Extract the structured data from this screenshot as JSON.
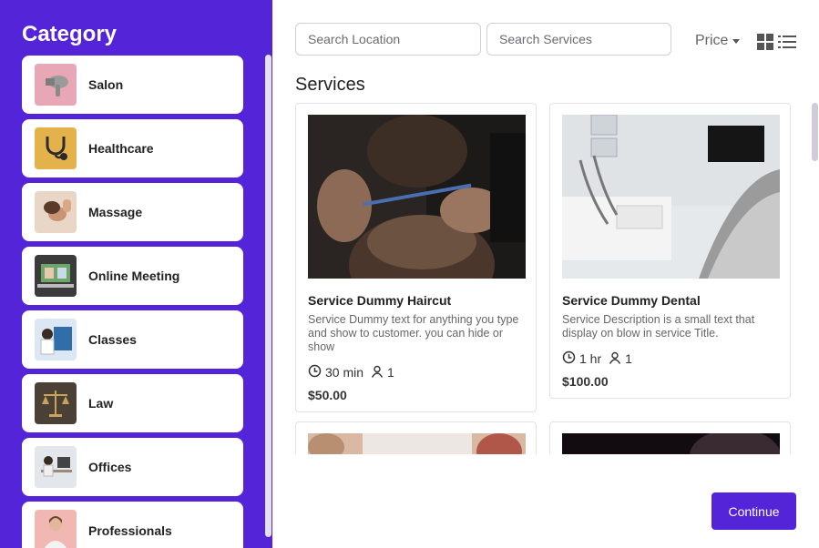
{
  "sidebar": {
    "title": "Category",
    "items": [
      {
        "label": "Salon",
        "icon": "hair-dryer-icon",
        "color": "#e8a7b6"
      },
      {
        "label": "Healthcare",
        "icon": "stethoscope-icon",
        "color": "#e3b24a"
      },
      {
        "label": "Massage",
        "icon": "massage-icon",
        "color": "#e9d6c6"
      },
      {
        "label": "Online Meeting",
        "icon": "laptop-meeting-icon",
        "color": "#3b3b3b"
      },
      {
        "label": "Classes",
        "icon": "classroom-icon",
        "color": "#8fb4d9"
      },
      {
        "label": "Law",
        "icon": "scales-icon",
        "color": "#6b5a3c"
      },
      {
        "label": "Offices",
        "icon": "office-icon",
        "color": "#d9dde3"
      },
      {
        "label": "Professionals",
        "icon": "professional-person-icon",
        "color": "#f1b7b2"
      }
    ]
  },
  "search": {
    "location_placeholder": "Search Location",
    "services_placeholder": "Search Services"
  },
  "toolbar": {
    "price_label": "Price",
    "grid_view_icon": "grid-view-icon",
    "list_view_icon": "list-view-icon"
  },
  "main": {
    "section_title": "Services",
    "cards": [
      {
        "title": "Service Dummy Haircut",
        "description": "Service Dummy text for anything you type and show to customer. you can hide or show",
        "duration": "30 min",
        "capacity": "1",
        "price": "$50.00"
      },
      {
        "title": "Service Dummy Dental",
        "description": "Service Description is a small text that display on blow in service Title.",
        "duration": "1 hr",
        "capacity": "1",
        "price": "$100.00"
      }
    ]
  },
  "footer": {
    "continue_label": "Continue"
  },
  "colors": {
    "accent": "#5324d8",
    "sidebar_bg": "#5324d8"
  }
}
